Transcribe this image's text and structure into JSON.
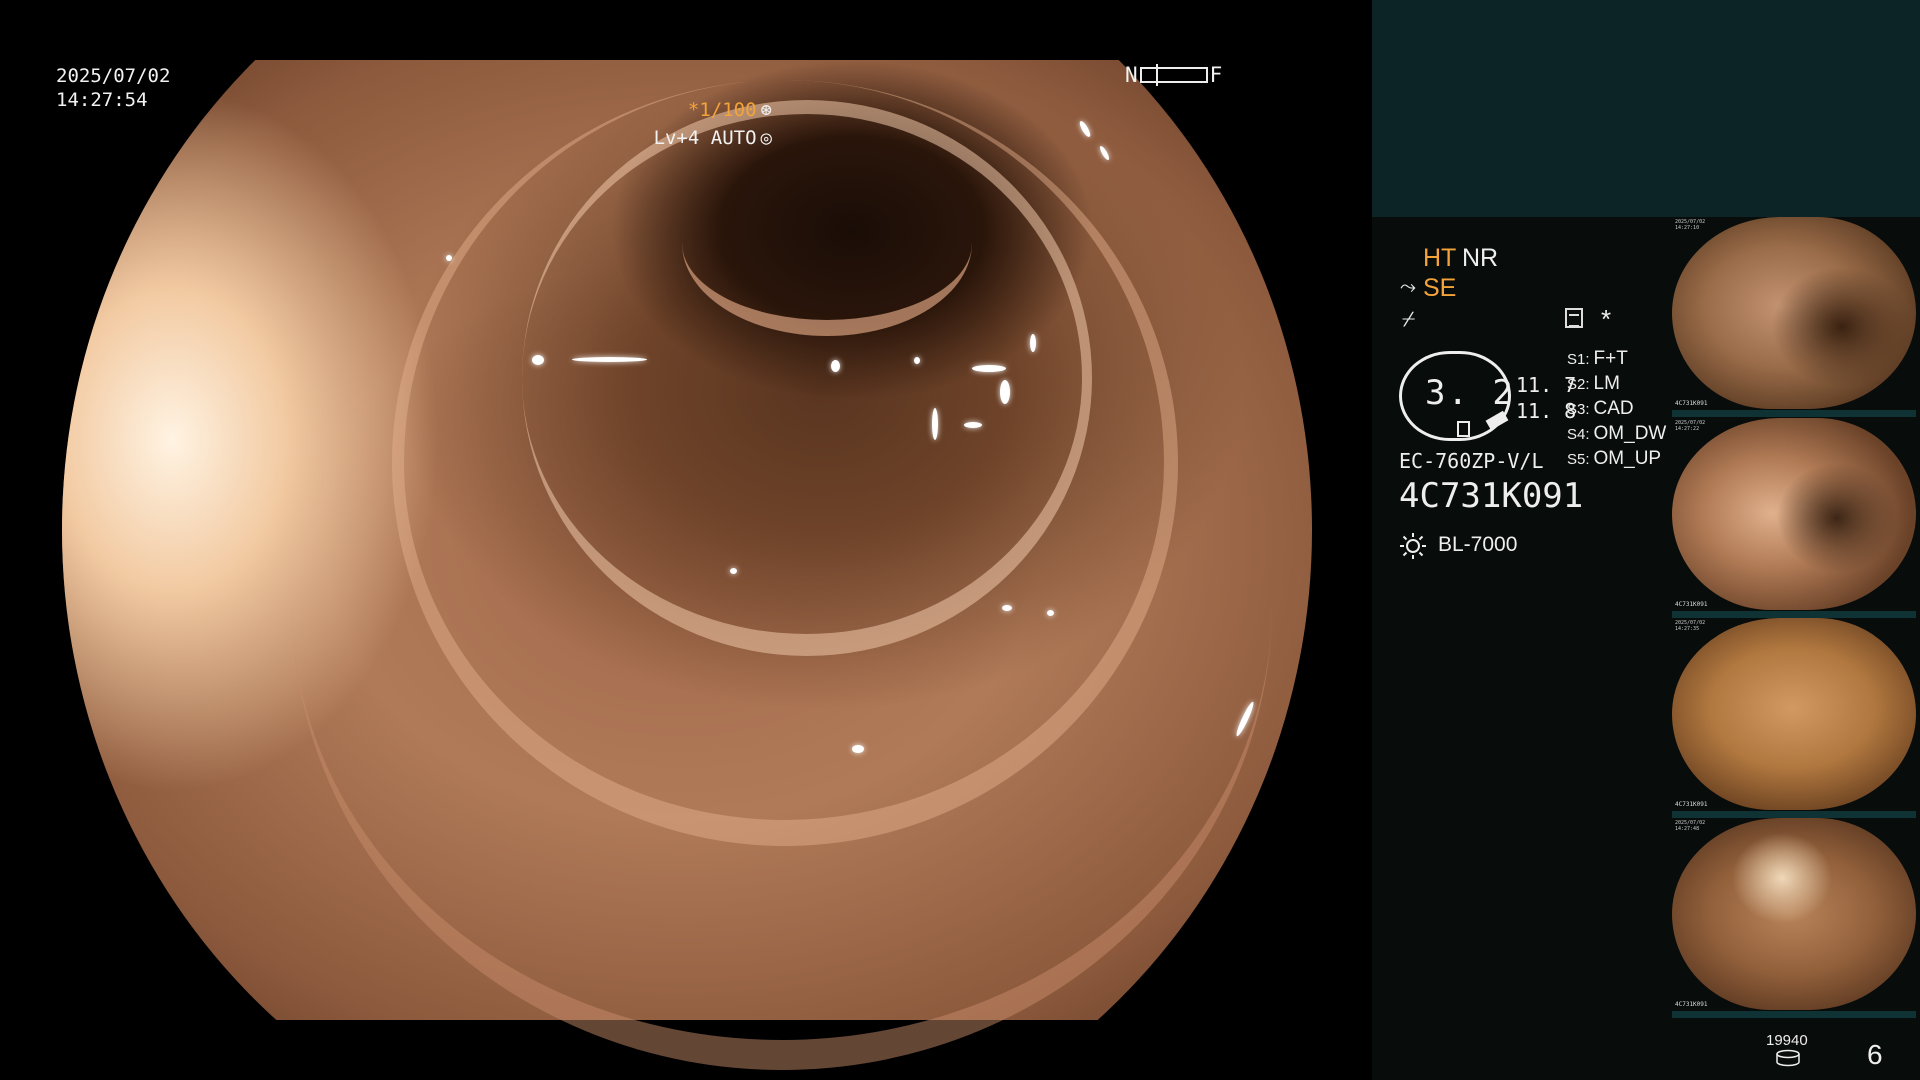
{
  "overlay": {
    "date": "2025/07/02",
    "time": "14:27:54",
    "focus_near": "N",
    "focus_far": "F",
    "shutter": "*1/100",
    "iris": "Lv+4 AUTO"
  },
  "panel": {
    "mode_ht": "HT",
    "mode_nr": "NR",
    "mode_se": "SE",
    "asterisk": "*",
    "scope_value": "3. 2",
    "value_1": "11. 7",
    "value_2": "11. 8",
    "presets": [
      {
        "key": "S1:",
        "label": "F+T"
      },
      {
        "key": "S2:",
        "label": "LM"
      },
      {
        "key": "S3:",
        "label": "CAD"
      },
      {
        "key": "S4:",
        "label": "OM_DW"
      },
      {
        "key": "S5:",
        "label": "OM_UP"
      }
    ],
    "scope_model": "EC-760ZP-V/L",
    "serial": "4C731K091",
    "light_source": "BL-7000",
    "storage_count": "19940",
    "image_count": "6"
  },
  "icons": {
    "shutter": "aperture-icon",
    "iris": "iris-icon",
    "light": "sun-icon",
    "storage": "storage-icon",
    "layout": "layout-icon"
  },
  "colors": {
    "accent_orange": "#f2a43a",
    "panel_top": "#0d2426",
    "panel_bg": "#080c0b"
  },
  "thumbnails": [
    {
      "date": "2025/07/02",
      "time": "14:27:10",
      "serial": "4C731K091"
    },
    {
      "date": "2025/07/02",
      "time": "14:27:22",
      "serial": "4C731K091"
    },
    {
      "date": "2025/07/02",
      "time": "14:27:35",
      "serial": "4C731K091"
    },
    {
      "date": "2025/07/02",
      "time": "14:27:48",
      "serial": "4C731K091"
    }
  ]
}
